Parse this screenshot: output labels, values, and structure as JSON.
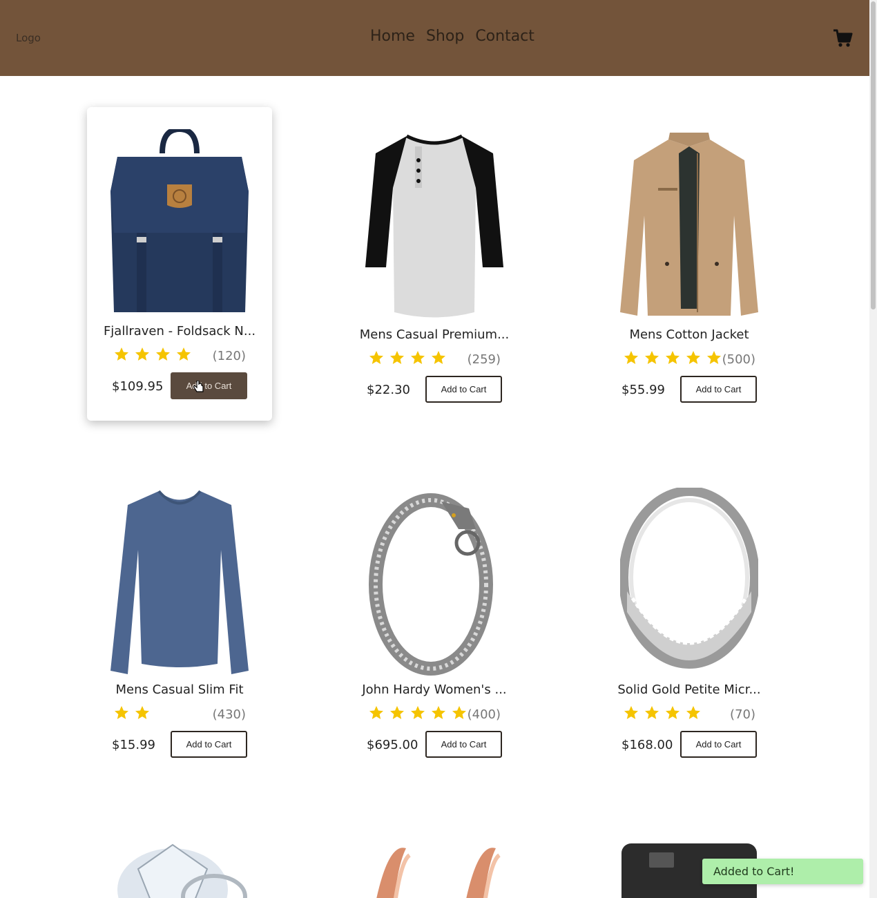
{
  "header": {
    "logo": "Logo",
    "nav": [
      "Home",
      "Shop",
      "Contact"
    ],
    "cart_icon": "shopping-cart-icon",
    "background_color": "#73543a"
  },
  "products": [
    {
      "title": "Fjallraven - Foldsack N...",
      "rating": 3.9,
      "stars_shown": 4,
      "count": "(120)",
      "price": "$109.95",
      "button": "Add to Cart",
      "image": "backpack",
      "hovered": true
    },
    {
      "title": "Mens Casual Premium...",
      "rating": 4.1,
      "stars_shown": 4,
      "count": "(259)",
      "price": "$22.30",
      "button": "Add to Cart",
      "image": "raglan-shirt"
    },
    {
      "title": "Mens Cotton Jacket",
      "rating": 4.7,
      "stars_shown": 5,
      "count": "(500)",
      "price": "$55.99",
      "button": "Add to Cart",
      "image": "jacket"
    },
    {
      "title": "Mens Casual Slim Fit",
      "rating": 2.1,
      "stars_shown": 2,
      "count": "(430)",
      "price": "$15.99",
      "button": "Add to Cart",
      "image": "long-sleeve-tee"
    },
    {
      "title": "John Hardy Women's ...",
      "rating": 4.6,
      "stars_shown": 5,
      "count": "(400)",
      "price": "$695.00",
      "button": "Add to Cart",
      "image": "dragon-bracelet"
    },
    {
      "title": "Solid Gold Petite Micr...",
      "rating": 3.9,
      "stars_shown": 4,
      "count": "(70)",
      "price": "$168.00",
      "button": "Add to Cart",
      "image": "silver-ring"
    }
  ],
  "partial_row": [
    "diamond-ring",
    "rose-gold-earrings",
    "hard-drive"
  ],
  "toast": "Added to Cart!",
  "colors": {
    "star": "#f5c400",
    "toast_bg": "#aeeeaa",
    "hover_button": "#5a4a3e"
  }
}
